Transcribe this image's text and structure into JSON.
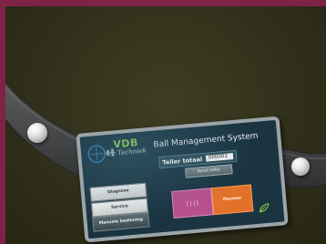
{
  "device": {
    "brand": "VDB",
    "brand_sub": "Techniek",
    "title": "Ball Management System",
    "teller_label": "Teller totaal",
    "teller_value": "000001",
    "reset_button": "Reset teller",
    "menu": [
      {
        "label": "Diagnose"
      },
      {
        "label": "Service"
      },
      {
        "label": "Manuele bediening"
      }
    ],
    "mode_button": "[||]",
    "pause_button": "Pauzeer"
  },
  "colors": {
    "frame": "#7e2345",
    "backdrop": "#302f1a",
    "panel": "#1a3441",
    "accent_green": "#8fd14f",
    "pink": "#b84f8e",
    "orange": "#e2712a"
  },
  "icons": [
    "vdb-logo-icon",
    "leaf-icon",
    "ball-icon"
  ]
}
